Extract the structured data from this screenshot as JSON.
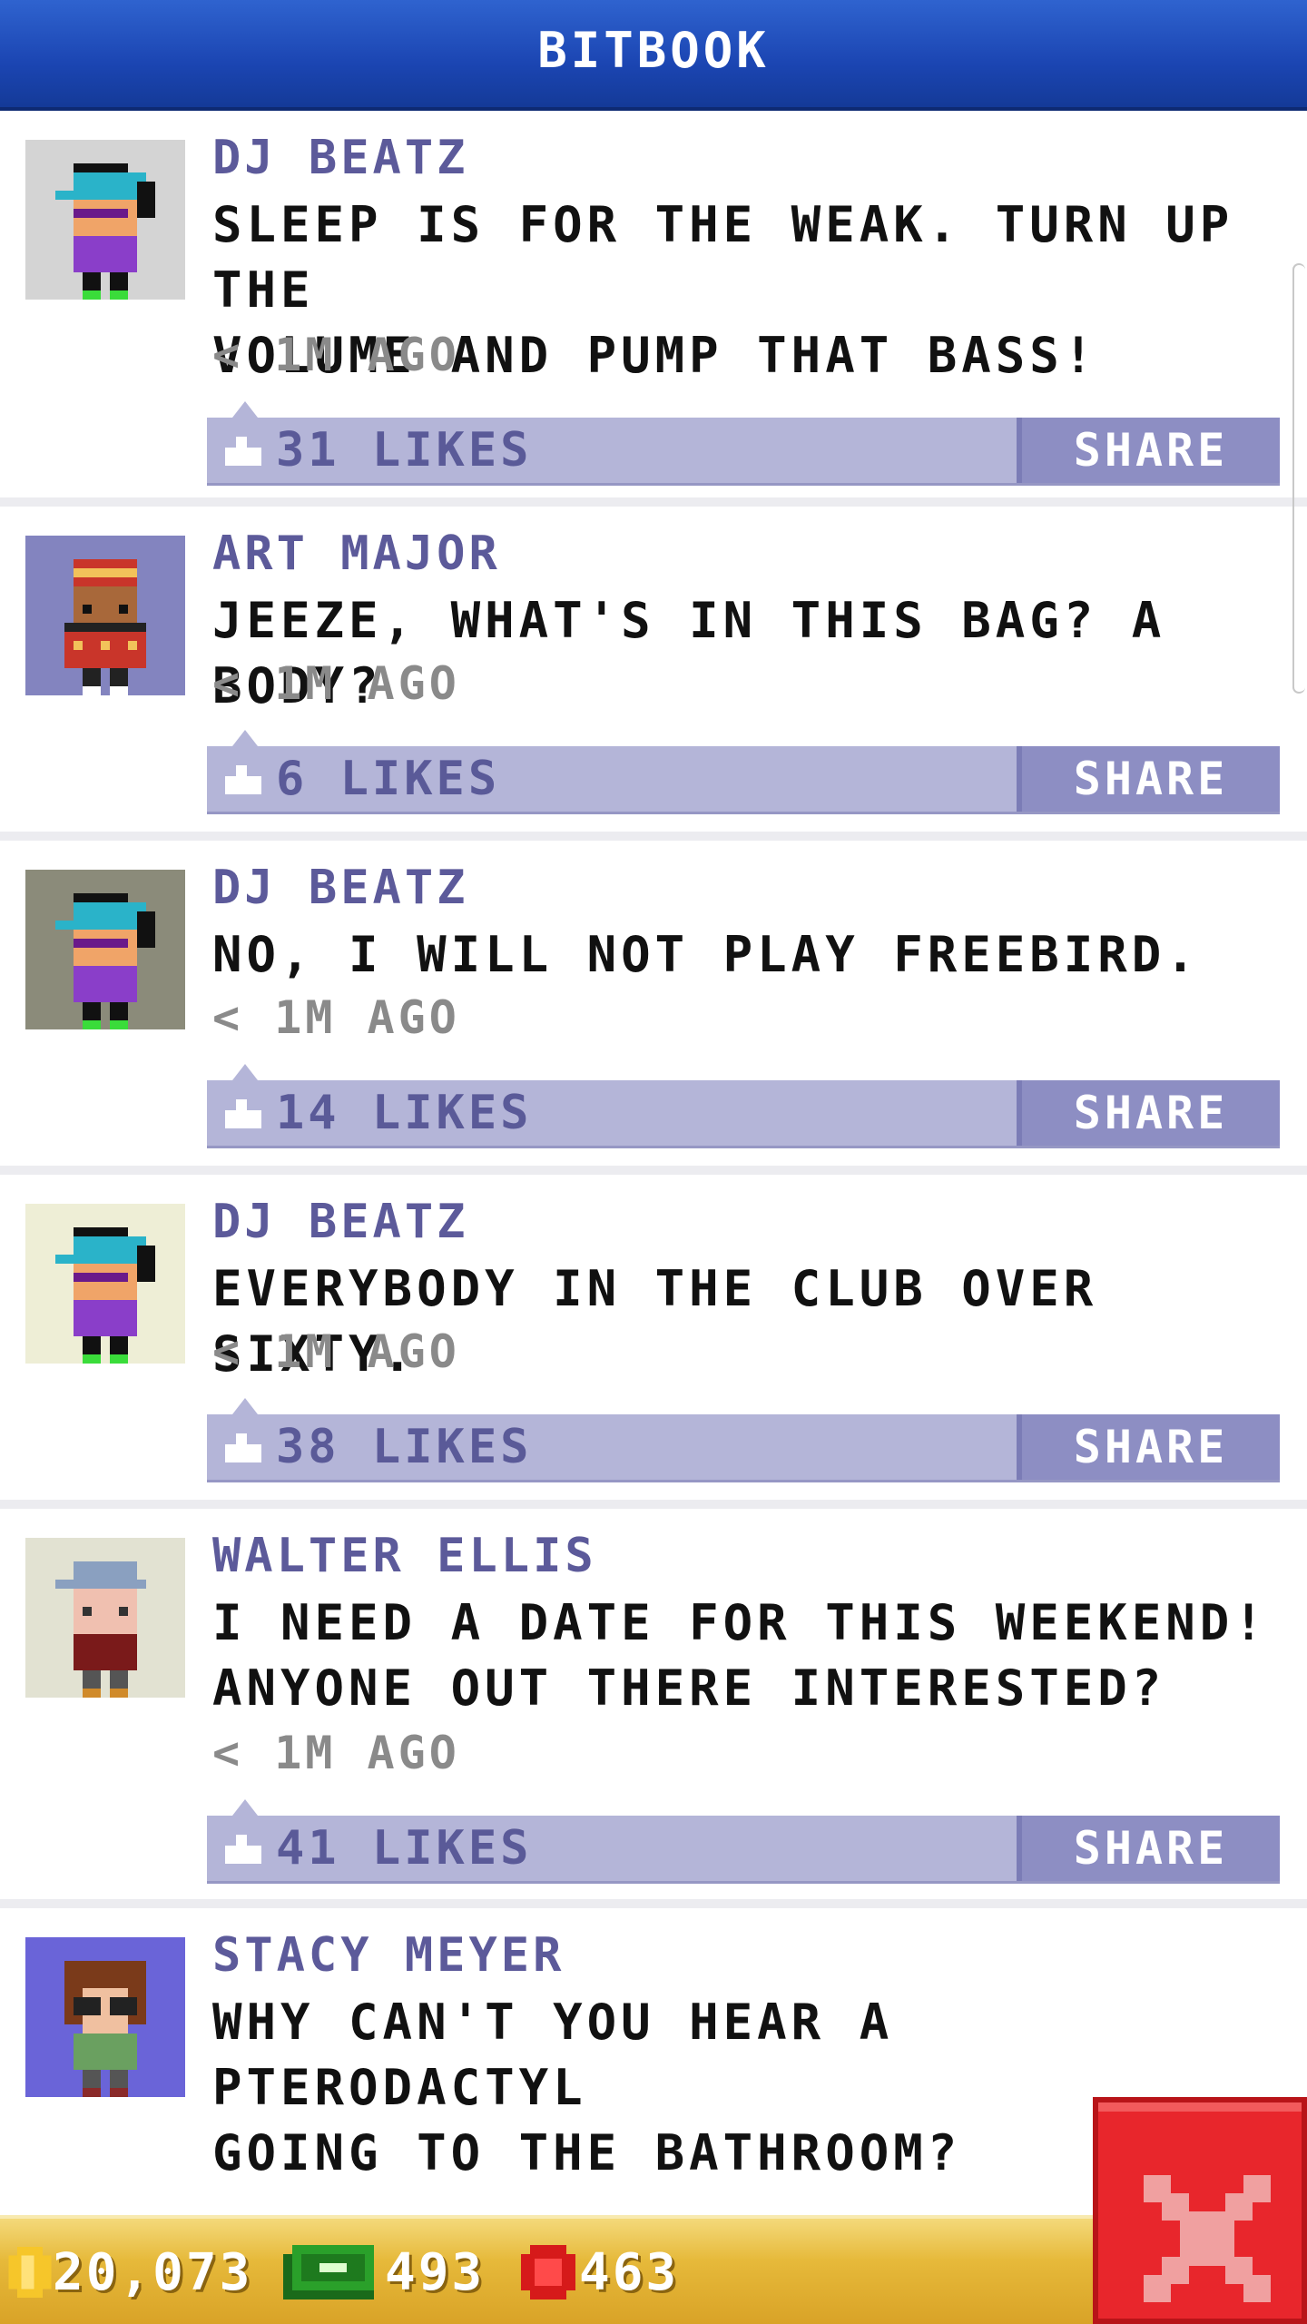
{
  "header": {
    "title": "BITBOOK"
  },
  "posts": [
    {
      "author": "DJ BEATZ",
      "message": "SLEEP IS FOR THE WEAK. TURN UP THE\nVOLUME AND PUMP THAT BASS!",
      "time": "< 1M AGO",
      "likes": "31 LIKES",
      "share": "SHARE",
      "avatar_bg": "#d4d4d4",
      "avatar_icon": "dj-avatar-icon"
    },
    {
      "author": "ART MAJOR",
      "message": "JEEZE, WHAT'S IN THIS BAG? A BODY?",
      "time": "< 1M AGO",
      "likes": "6 LIKES",
      "share": "SHARE",
      "avatar_bg": "#8384bf",
      "avatar_icon": "art-major-avatar-icon"
    },
    {
      "author": "DJ BEATZ",
      "message": "NO, I WILL NOT PLAY FREEBIRD.",
      "time": "< 1M AGO",
      "likes": "14 LIKES",
      "share": "SHARE",
      "avatar_bg": "#8b8b7a",
      "avatar_icon": "dj-avatar-icon"
    },
    {
      "author": "DJ BEATZ",
      "message": "EVERYBODY IN THE CLUB OVER SIXTY.",
      "time": "< 1M AGO",
      "likes": "38 LIKES",
      "share": "SHARE",
      "avatar_bg": "#eeeed6",
      "avatar_icon": "dj-avatar-icon"
    },
    {
      "author": "WALTER ELLIS",
      "message": "I NEED A DATE FOR THIS WEEKEND!\nANYONE OUT THERE INTERESTED?",
      "time": "< 1M AGO",
      "likes": "41 LIKES",
      "share": "SHARE",
      "avatar_bg": "#e2e2d2",
      "avatar_icon": "walter-avatar-icon"
    },
    {
      "author": "STACY MEYER",
      "message": "WHY CAN'T YOU HEAR A PTERODACTYL\nGOING TO THE BATHROOM?",
      "time": "",
      "likes": "",
      "share": "",
      "avatar_bg": "#6a64d8",
      "avatar_icon": "stacy-avatar-icon"
    }
  ],
  "bottom_bar": {
    "coins": "20,073",
    "bux": "493",
    "tokens": "463"
  },
  "colors": {
    "header_blue": "#1b45b2",
    "like_bar": "#b4b5d8",
    "share_button": "#8d8ec3",
    "author_text": "#5c5a9a",
    "close_red": "#e8262c",
    "bottom_gold": "#e6b93a"
  }
}
